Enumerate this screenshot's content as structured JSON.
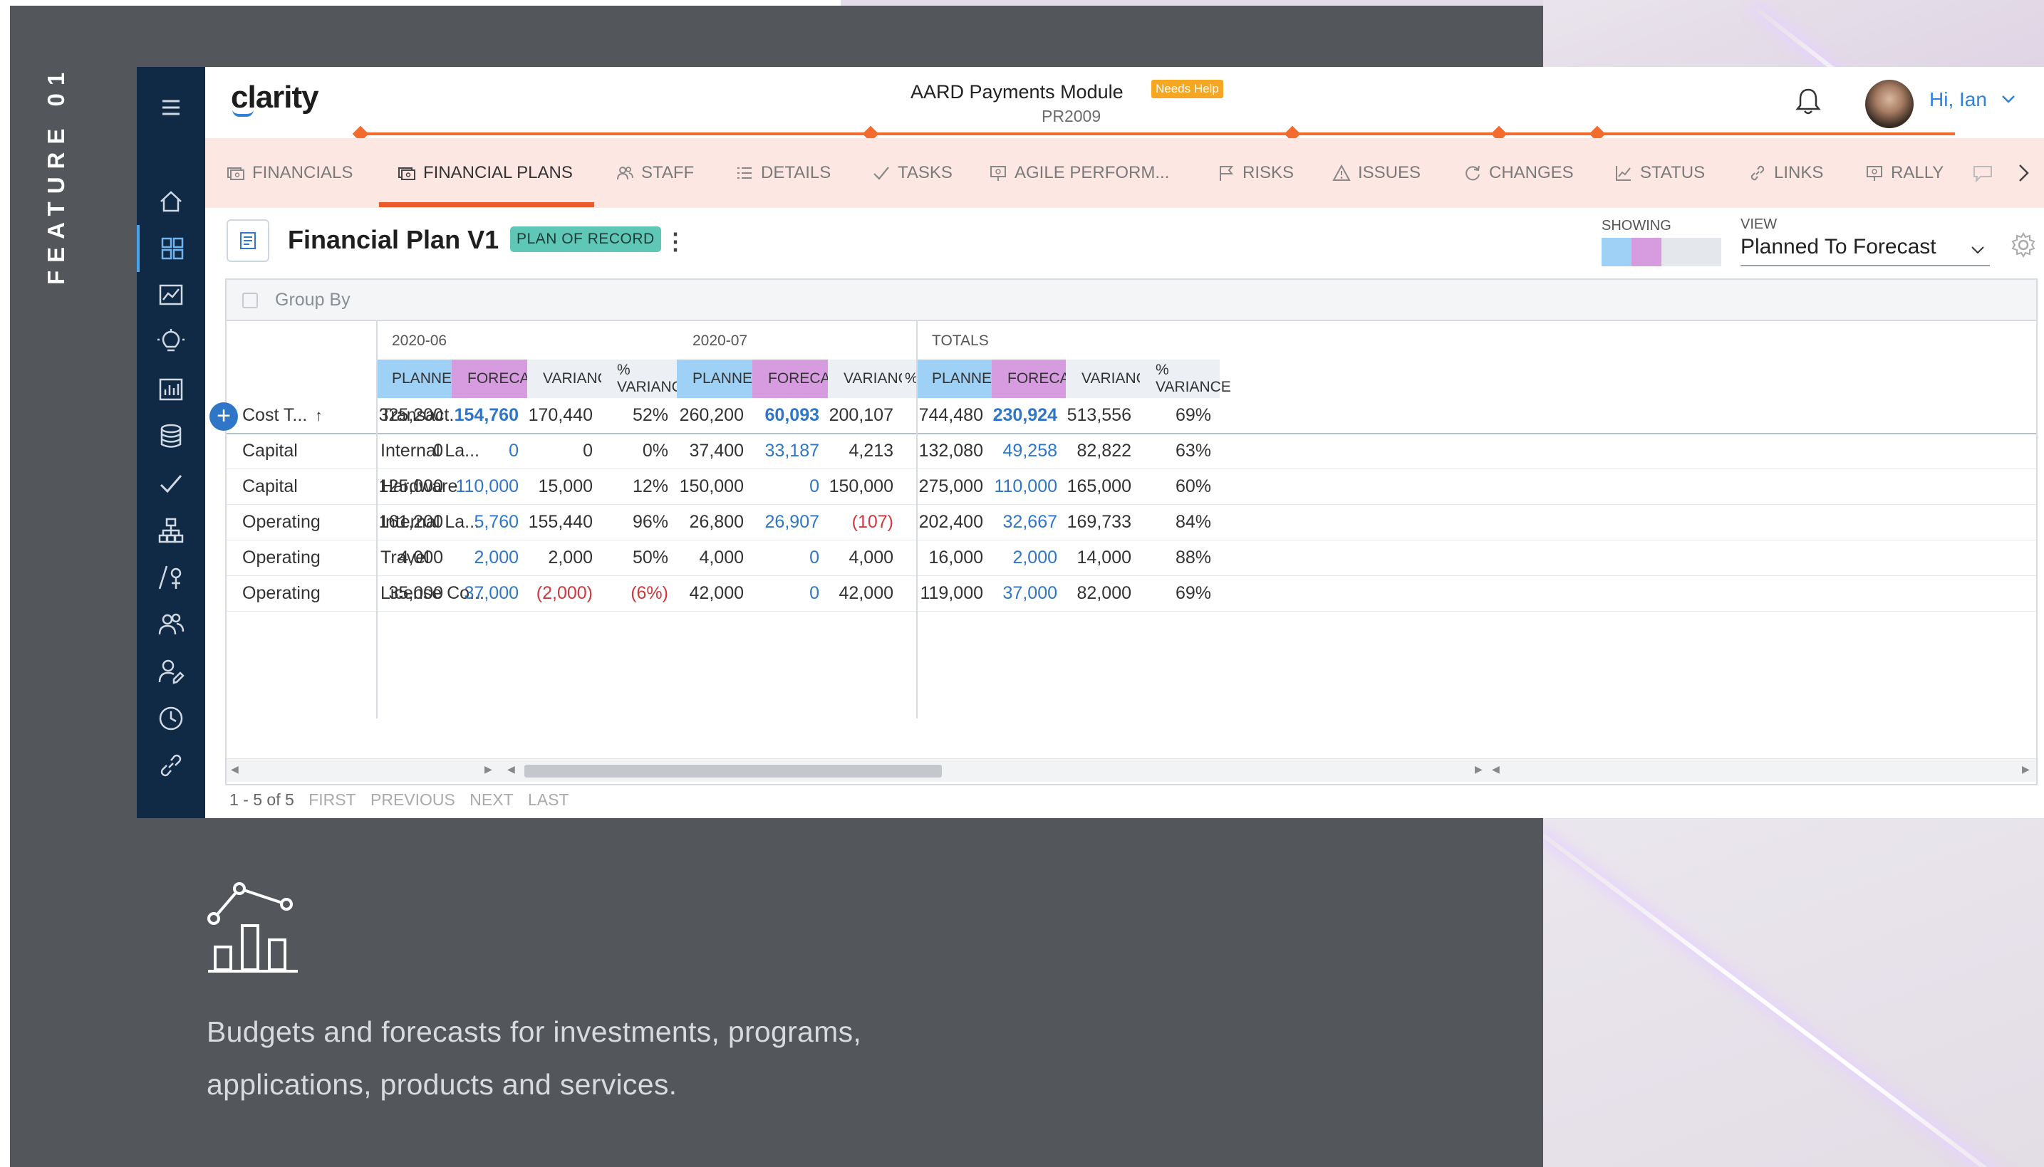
{
  "feature_label": "FEATURE 01",
  "caption": "Budgets and forecasts for investments, programs, applications, products and services.",
  "app": {
    "logo": "clarity",
    "project_title": "AARD Payments Module",
    "needs_help": "Needs Help",
    "project_code": "PR2009",
    "greeting": "Hi, Ian",
    "sidebar_icons": [
      "home-icon",
      "dashboard-grid-icon",
      "trend-chart-icon",
      "lightbulb-icon",
      "bar-chart-icon",
      "database-icon",
      "checkmark-icon",
      "hierarchy-icon",
      "roadmap-icon",
      "team-icon",
      "user-edit-icon",
      "clock-icon",
      "link-icon"
    ],
    "tabs": [
      {
        "label": "FINANCIALS",
        "icon": "money-icon"
      },
      {
        "label": "FINANCIAL PLANS",
        "icon": "money-icon"
      },
      {
        "label": "STAFF",
        "icon": "staff-icon"
      },
      {
        "label": "DETAILS",
        "icon": "list-icon"
      },
      {
        "label": "TASKS",
        "icon": "check-icon"
      },
      {
        "label": "AGILE PERFORM...",
        "icon": "presentation-icon"
      },
      {
        "label": "RISKS",
        "icon": "flag-icon"
      },
      {
        "label": "ISSUES",
        "icon": "warning-icon"
      },
      {
        "label": "CHANGES",
        "icon": "changes-icon"
      },
      {
        "label": "STATUS",
        "icon": "status-chart-icon"
      },
      {
        "label": "LINKS",
        "icon": "link-icon"
      },
      {
        "label": "RALLY",
        "icon": "presentation-icon"
      }
    ],
    "plan": {
      "title": "Financial Plan V1",
      "badge": "PLAN OF RECORD",
      "showing_label": "SHOWING",
      "view_label": "VIEW",
      "view_value": "Planned To Forecast",
      "showing_colors": [
        "#9fd0f5",
        "#d79ce0",
        "#e4e7eb",
        "#e4e7eb"
      ]
    },
    "grid": {
      "group_by": "Group By",
      "bands": [
        "2020-06",
        "2020-07",
        "TOTALS"
      ],
      "col_headers": [
        "PLANNED",
        "FORECAST",
        "VARIANCE",
        "% VARIANCE",
        "PLANNED",
        "FORECAST",
        "VARIANCE",
        "%",
        "PLANNED",
        "FORECAST",
        "VARIANCE",
        "% VARIANCE"
      ],
      "fixed_headers": [
        "Cost T...",
        "Transact..."
      ],
      "total_row": [
        "325,200",
        "154,760",
        "170,440",
        "52%",
        "260,200",
        "60,093",
        "200,107",
        "",
        "744,480",
        "230,924",
        "513,556",
        "69%"
      ],
      "rows": [
        {
          "c1": "Capital",
          "c2": "Internal La...",
          "v": [
            "0",
            "0",
            "0",
            "0%",
            "37,400",
            "33,187",
            "4,213",
            "",
            "132,080",
            "49,258",
            "82,822",
            "63%"
          ]
        },
        {
          "c1": "Capital",
          "c2": "Hardware",
          "v": [
            "125,000",
            "110,000",
            "15,000",
            "12%",
            "150,000",
            "0",
            "150,000",
            "",
            "275,000",
            "110,000",
            "165,000",
            "60%"
          ]
        },
        {
          "c1": "Operating",
          "c2": "Internal La...",
          "v": [
            "161,200",
            "5,760",
            "155,440",
            "96%",
            "26,800",
            "26,907",
            "(107)",
            "",
            "202,400",
            "32,667",
            "169,733",
            "84%"
          ]
        },
        {
          "c1": "Operating",
          "c2": "Travel",
          "v": [
            "4,000",
            "2,000",
            "2,000",
            "50%",
            "4,000",
            "0",
            "4,000",
            "",
            "16,000",
            "2,000",
            "14,000",
            "88%"
          ]
        },
        {
          "c1": "Operating",
          "c2": "License Co...",
          "v": [
            "35,000",
            "37,000",
            "(2,000)",
            "(6%)",
            "42,000",
            "0",
            "42,000",
            "",
            "119,000",
            "37,000",
            "82,000",
            "69%"
          ]
        }
      ]
    },
    "pager": {
      "range": "1 - 5 of 5",
      "first": "FIRST",
      "previous": "PREVIOUS",
      "next": "NEXT",
      "last": "LAST"
    }
  }
}
